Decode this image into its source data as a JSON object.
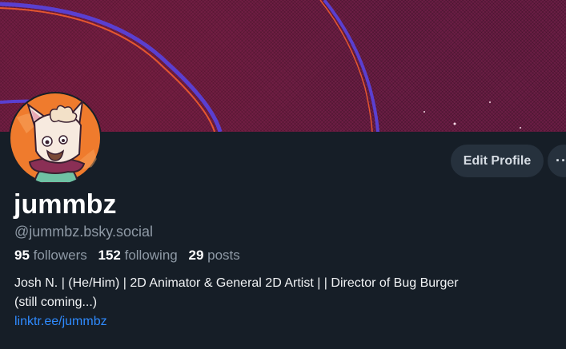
{
  "profile": {
    "display_name": "jummbz",
    "handle": "@jummbz.bsky.social",
    "stats": {
      "followers_count": "95",
      "followers_label": "followers",
      "following_count": "152",
      "following_label": "following",
      "posts_count": "29",
      "posts_label": "posts"
    },
    "bio_lines": [
      "Josh N. | (He/Him) | 2D Animator & General 2D Artist |  | Director of Bug Burger",
      "(still coming...)"
    ],
    "bio_link": "linktr.ee/jummbz"
  },
  "actions": {
    "edit_profile_label": "Edit Profile",
    "more_label": "···"
  },
  "colors": {
    "background": "#161e27",
    "banner": "#6b1e45",
    "link": "#2f8bff",
    "muted_text": "#8f9aa6",
    "button_bg": "#26313d",
    "avatar_bg": "#ef7b2d"
  },
  "icons": {
    "avatar": "cartoon-cat-character-avatar",
    "more": "ellipsis-icon"
  }
}
